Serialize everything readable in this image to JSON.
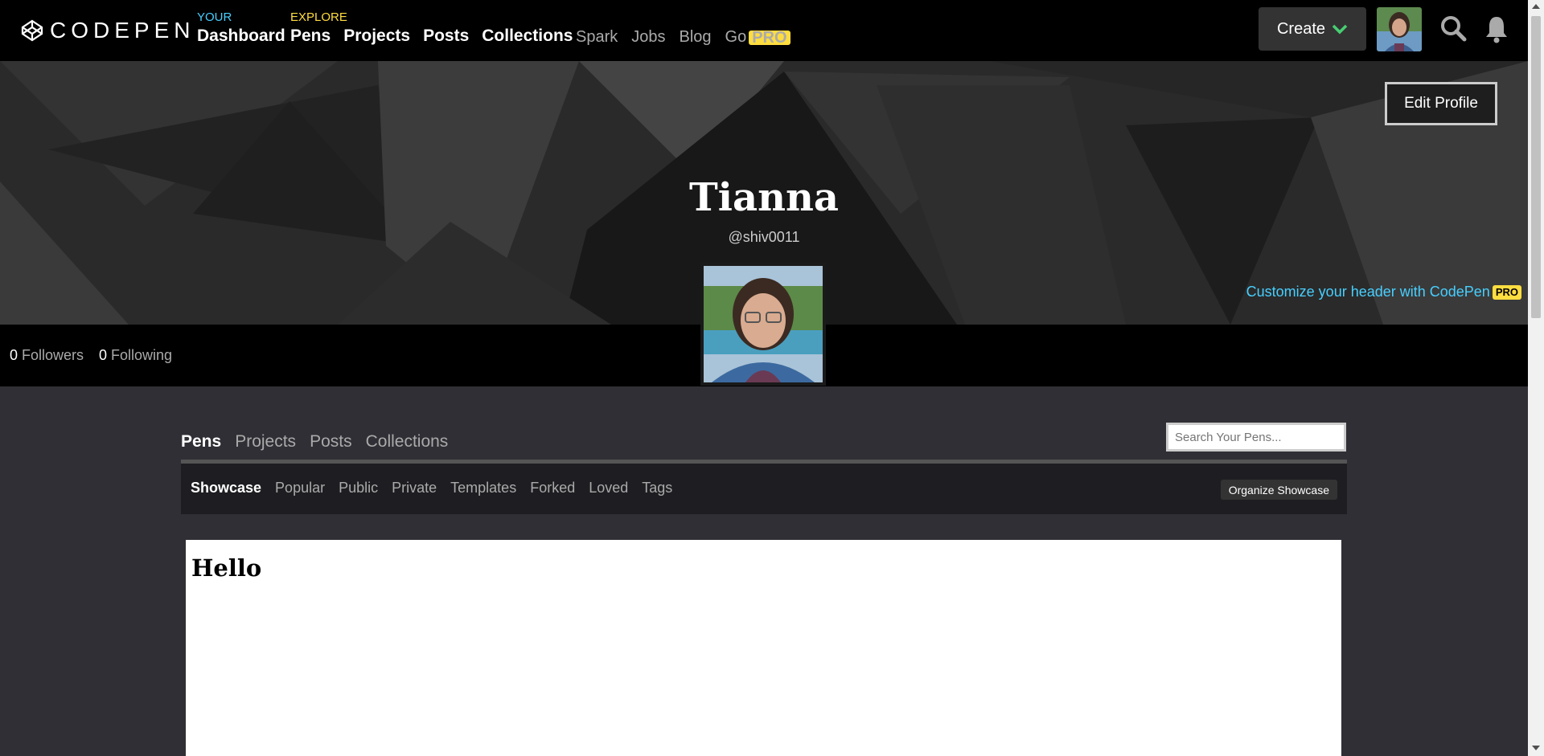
{
  "nav": {
    "logo_text": "CODEPEN",
    "your_kicker": "YOUR",
    "your_links": [
      "Dashboard"
    ],
    "explore_kicker": "EXPLORE",
    "explore_links": [
      "Pens",
      "Projects",
      "Posts",
      "Collections"
    ],
    "secondary_links": [
      "Spark",
      "Jobs",
      "Blog",
      "Go"
    ],
    "go_badge": "PRO",
    "create_label": "Create",
    "your_color": "#47cfff",
    "explore_color": "#ffdd40"
  },
  "profile": {
    "edit_label": "Edit Profile",
    "name": "Tianna",
    "handle": "@shiv0011",
    "customize_text": "Customize your header with CodePen",
    "customize_badge": "PRO",
    "followers_count": "0",
    "followers_label": "Followers",
    "following_count": "0",
    "following_label": "Following"
  },
  "content": {
    "tabs": [
      "Pens",
      "Projects",
      "Posts",
      "Collections"
    ],
    "search_placeholder": "Search Your Pens...",
    "subtabs": [
      "Showcase",
      "Popular",
      "Public",
      "Private",
      "Templates",
      "Forked",
      "Loved",
      "Tags"
    ],
    "organize_label": "Organize Showcase",
    "preview_heading": "Hello"
  }
}
